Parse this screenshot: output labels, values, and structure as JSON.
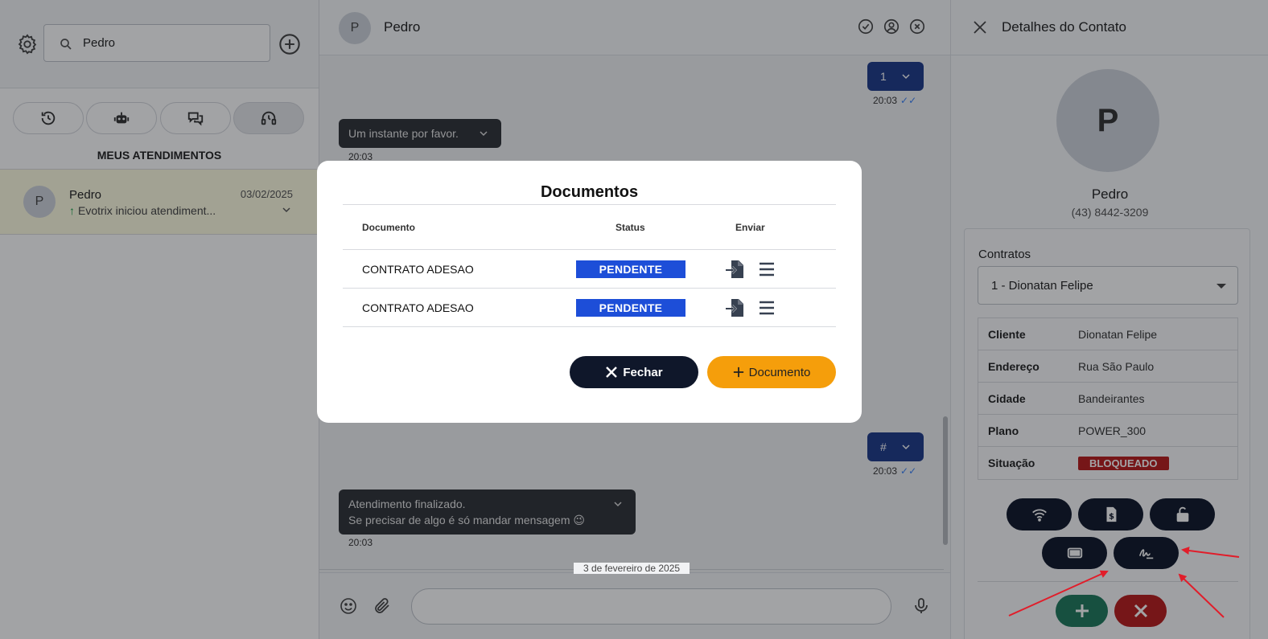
{
  "left": {
    "search_value": "Pedro",
    "section_title": "MEUS ATENDIMENTOS",
    "conversation": {
      "avatar": "P",
      "name": "Pedro",
      "date": "03/02/2025",
      "preview": "Evotrix iniciou atendiment..."
    }
  },
  "chat": {
    "contact_avatar": "P",
    "contact_name": "Pedro",
    "messages": [
      {
        "dir": "out",
        "text": "1",
        "time": "20:03"
      },
      {
        "dir": "in",
        "text": "Um instante por favor.",
        "time": "20:03"
      },
      {
        "dir": "out",
        "text": "#",
        "time": "20:03"
      },
      {
        "dir": "in",
        "line1": "Atendimento finalizado.",
        "line2": "Se precisar de algo é só mandar mensagem 😉",
        "time": "20:03"
      }
    ],
    "day_separator": "3 de fevereiro de 2025",
    "ticks": "✓✓"
  },
  "contact": {
    "header_title": "Detalhes do Contato",
    "avatar": "P",
    "name": "Pedro",
    "phone": "(43) 8442-3209",
    "contracts_label": "Contratos",
    "contract_selected": "1 - Dionatan Felipe",
    "info": {
      "cliente_k": "Cliente",
      "cliente_v": "Dionatan Felipe",
      "endereco_k": "Endereço",
      "endereco_v": "Rua São Paulo",
      "cidade_k": "Cidade",
      "cidade_v": "Bandeirantes",
      "plano_k": "Plano",
      "plano_v": "POWER_300",
      "situacao_k": "Situação",
      "situacao_v": "BLOQUEADO"
    }
  },
  "modal": {
    "title": "Documentos",
    "headers": {
      "doc": "Documento",
      "status": "Status",
      "send": "Enviar"
    },
    "rows": [
      {
        "doc": "CONTRATO ADESAO",
        "status": "PENDENTE"
      },
      {
        "doc": "CONTRATO ADESAO",
        "status": "PENDENTE"
      }
    ],
    "close_label": "Fechar",
    "add_label": "Documento"
  },
  "colors": {
    "primary_dark": "#0f172a",
    "status_blue": "#1d4ed8",
    "accent_orange": "#f59e0b",
    "danger_red": "#b91c1c",
    "confirm_green": "#1f7a5c",
    "annotation_arrow": "#e11d2a"
  }
}
